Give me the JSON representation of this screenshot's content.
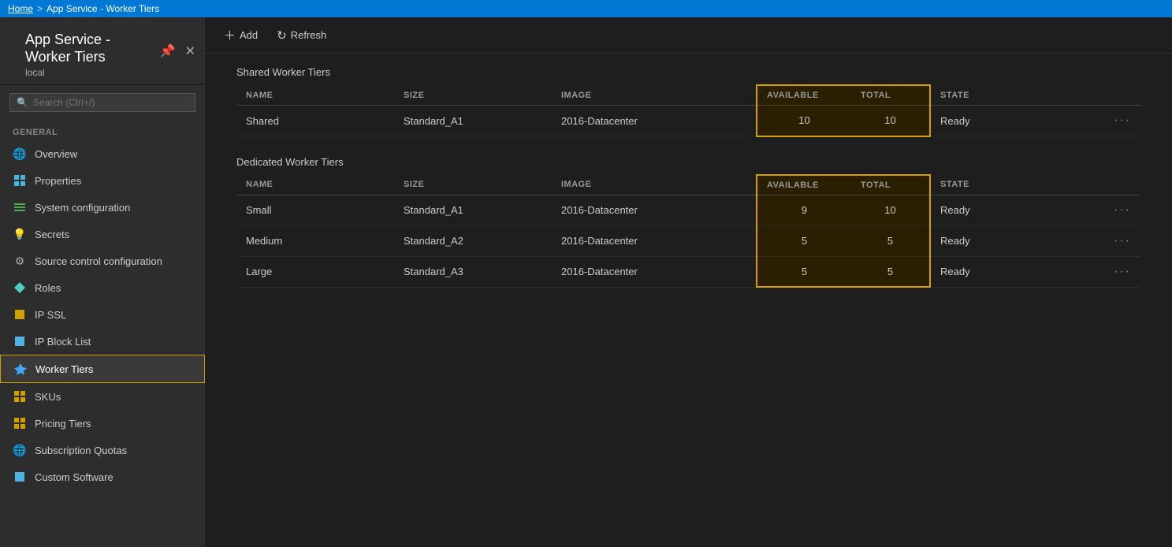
{
  "topbar": {
    "home": "Home",
    "separator": ">",
    "current": "App Service - Worker Tiers"
  },
  "sidebar": {
    "title": "App Service - Worker Tiers",
    "subtitle": "local",
    "search_placeholder": "Search (Ctrl+/)",
    "section_general": "GENERAL",
    "items": [
      {
        "id": "overview",
        "label": "Overview",
        "icon": "🌐",
        "icon_class": "icon-green",
        "active": false
      },
      {
        "id": "properties",
        "label": "Properties",
        "icon": "▦",
        "icon_class": "icon-blue",
        "active": false
      },
      {
        "id": "system-configuration",
        "label": "System configuration",
        "icon": "≡",
        "icon_class": "icon-green",
        "active": false
      },
      {
        "id": "secrets",
        "label": "Secrets",
        "icon": "💡",
        "icon_class": "icon-yellow",
        "active": false
      },
      {
        "id": "source-control",
        "label": "Source control configuration",
        "icon": "⚙",
        "icon_class": "icon-gray",
        "active": false
      },
      {
        "id": "roles",
        "label": "Roles",
        "icon": "◈",
        "icon_class": "icon-cyan",
        "active": false
      },
      {
        "id": "ip-ssl",
        "label": "IP SSL",
        "icon": "▪",
        "icon_class": "icon-yellow",
        "active": false
      },
      {
        "id": "ip-block",
        "label": "IP Block List",
        "icon": "▪",
        "icon_class": "icon-blue",
        "active": false
      },
      {
        "id": "worker-tiers",
        "label": "Worker Tiers",
        "icon": "✦",
        "icon_class": "icon-lightblue",
        "active": true
      },
      {
        "id": "skus",
        "label": "SKUs",
        "icon": "▦",
        "icon_class": "icon-yellow",
        "active": false
      },
      {
        "id": "pricing-tiers",
        "label": "Pricing Tiers",
        "icon": "▦",
        "icon_class": "icon-yellow",
        "active": false
      },
      {
        "id": "subscription-quotas",
        "label": "Subscription Quotas",
        "icon": "🌐",
        "icon_class": "icon-green",
        "active": false
      },
      {
        "id": "custom-software",
        "label": "Custom Software",
        "icon": "▪",
        "icon_class": "icon-blue",
        "active": false
      }
    ]
  },
  "toolbar": {
    "add_label": "Add",
    "refresh_label": "Refresh"
  },
  "shared_section": {
    "title": "Shared Worker Tiers",
    "columns": {
      "name": "NAME",
      "size": "SIZE",
      "image": "IMAGE",
      "available": "AVAILABLE",
      "total": "TOTAL",
      "state": "STATE"
    },
    "rows": [
      {
        "name": "Shared",
        "size": "Standard_A1",
        "image": "2016-Datacenter",
        "available": "10",
        "total": "10",
        "state": "Ready"
      }
    ]
  },
  "dedicated_section": {
    "title": "Dedicated Worker Tiers",
    "columns": {
      "name": "NAME",
      "size": "SIZE",
      "image": "IMAGE",
      "available": "AVAILABLE",
      "total": "TOTAL",
      "state": "STATE"
    },
    "rows": [
      {
        "name": "Small",
        "size": "Standard_A1",
        "image": "2016-Datacenter",
        "available": "9",
        "total": "10",
        "state": "Ready"
      },
      {
        "name": "Medium",
        "size": "Standard_A2",
        "image": "2016-Datacenter",
        "available": "5",
        "total": "5",
        "state": "Ready"
      },
      {
        "name": "Large",
        "size": "Standard_A3",
        "image": "2016-Datacenter",
        "available": "5",
        "total": "5",
        "state": "Ready"
      }
    ]
  }
}
